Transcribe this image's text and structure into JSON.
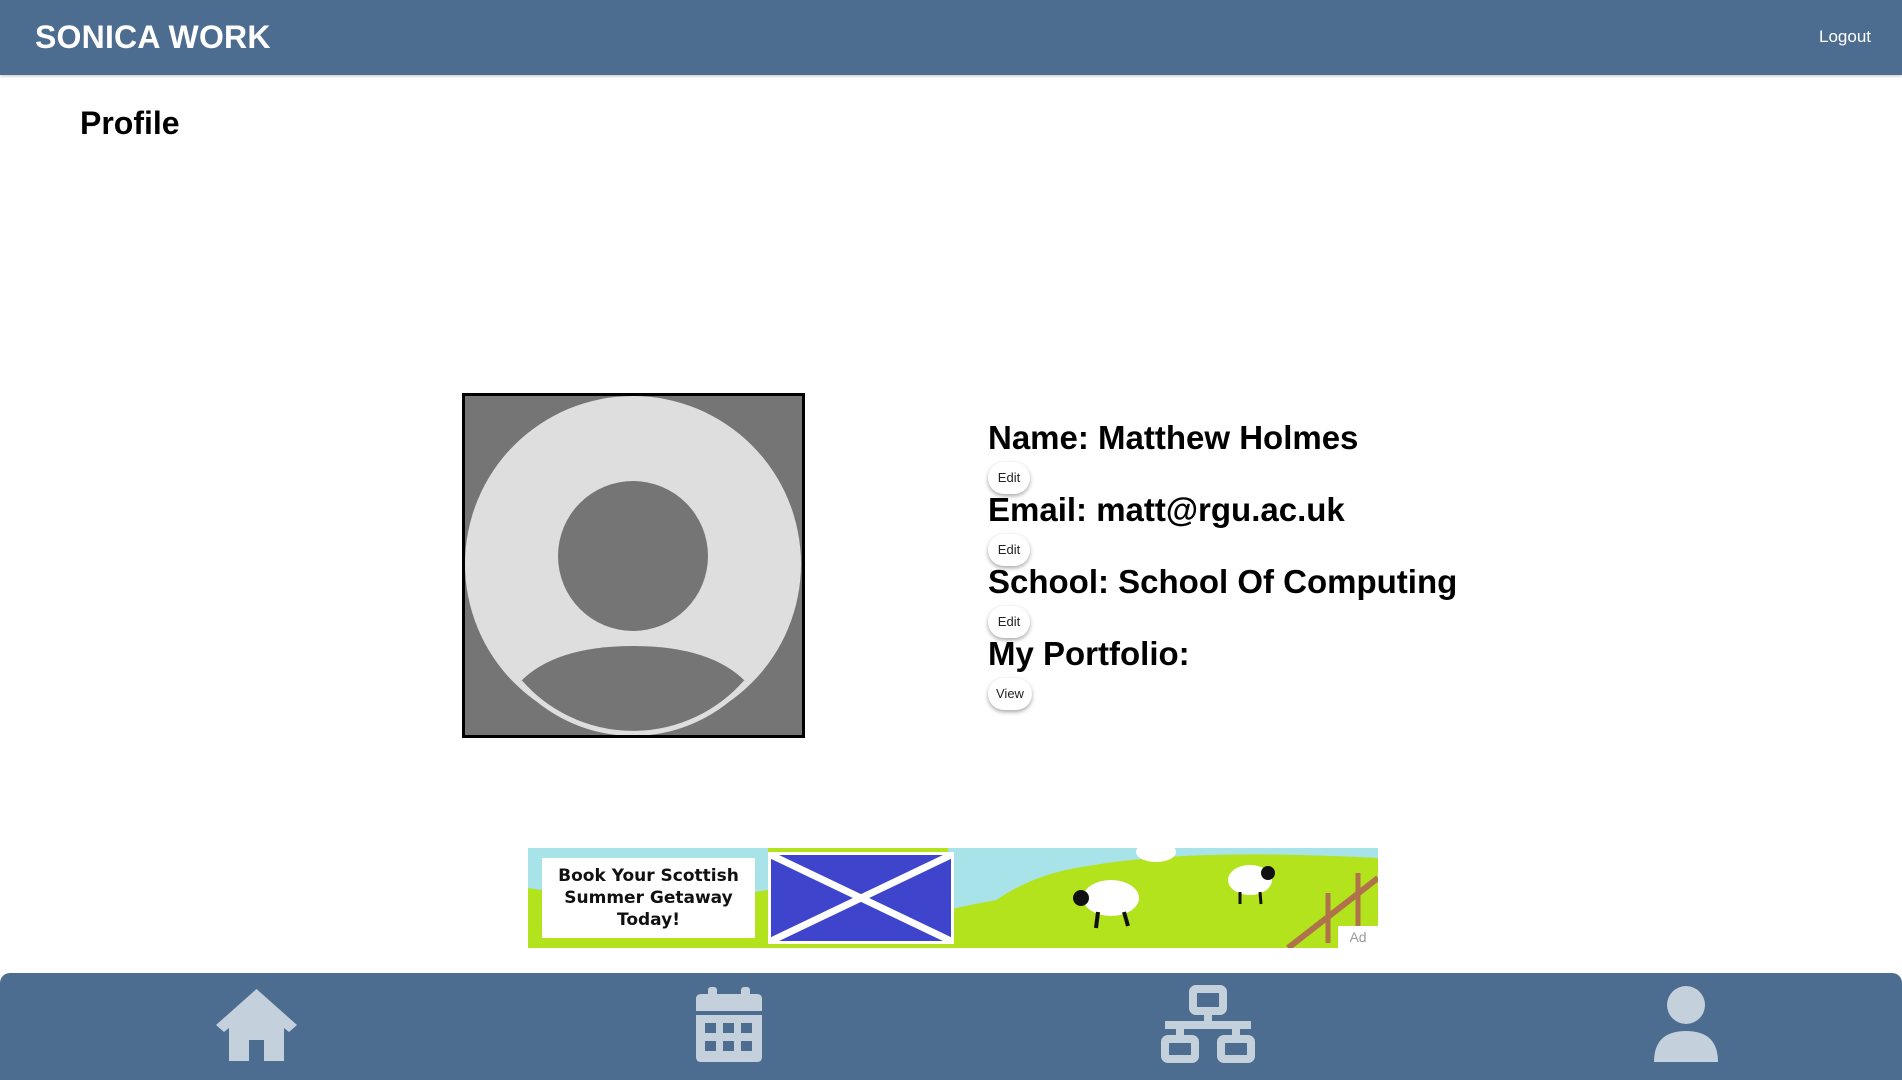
{
  "header": {
    "brand": "SONICA WORK",
    "logout_label": "Logout"
  },
  "page": {
    "title": "Profile"
  },
  "profile": {
    "name_line": "Name: Matthew Holmes",
    "email_line": "Email: matt@rgu.ac.uk",
    "school_line": "School: School Of Computing",
    "portfolio_line": "My Portfolio:",
    "edit_label": "Edit",
    "view_label": "View"
  },
  "ad": {
    "text": "Book Your Scottish Summer Getaway Today!",
    "label": "Ad"
  },
  "bottom_nav": [
    {
      "icon": "home-icon"
    },
    {
      "icon": "calendar-icon"
    },
    {
      "icon": "network-icon"
    },
    {
      "icon": "user-icon"
    }
  ],
  "colors": {
    "header_bg": "#4c6d8f",
    "nav_icon": "#c5d0dd",
    "avatar_bg": "#757575",
    "avatar_circle": "#dedede"
  }
}
